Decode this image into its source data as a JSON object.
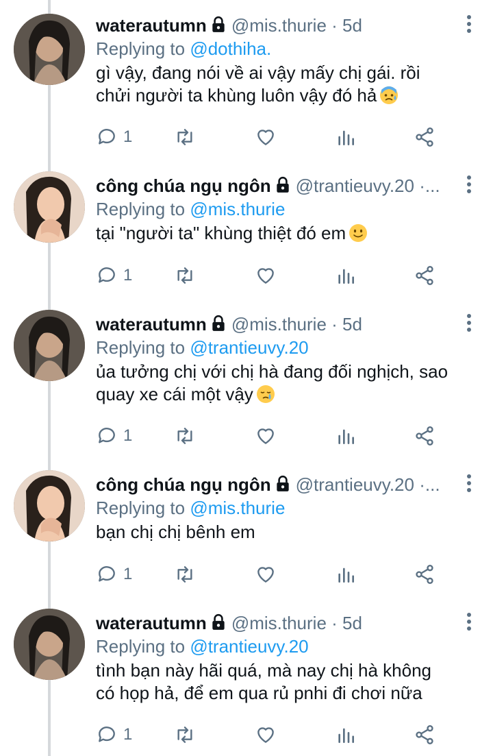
{
  "tweets": [
    {
      "name": "waterautumn",
      "handle": "@mis.thurie",
      "meta": " · 5d",
      "replying_label": "Replying to ",
      "replying_to": "@dothiha.",
      "lines": [
        "gì vậy, đang nói về ai vậy mấy chị gái. rồi",
        "chửi người ta khùng luôn vậy đó hả"
      ],
      "emoji": "anxious-sweat-emoji",
      "replies": "1"
    },
    {
      "name": "công chúa ngụ ngôn",
      "handle": "@trantieuvy.20",
      "meta": " ·...",
      "replying_label": "Replying to ",
      "replying_to": "@mis.thurie",
      "lines": [
        "tại \"người ta\" khùng thiệt đó em"
      ],
      "emoji": "slight-smile-emoji",
      "replies": "1"
    },
    {
      "name": "waterautumn",
      "handle": "@mis.thurie",
      "meta": " · 5d",
      "replying_label": "Replying to ",
      "replying_to": "@trantieuvy.20",
      "lines": [
        "ủa tưởng chị với chị hà đang đối nghịch, sao",
        "quay xe cái một vậy"
      ],
      "emoji": "crying-emoji",
      "replies": "1"
    },
    {
      "name": "công chúa ngụ ngôn",
      "handle": "@trantieuvy.20",
      "meta": " ·...",
      "replying_label": "Replying to ",
      "replying_to": "@mis.thurie",
      "lines": [
        "bạn chị chị bênh em"
      ],
      "emoji": "",
      "replies": "1"
    },
    {
      "name": "waterautumn",
      "handle": "@mis.thurie",
      "meta": " · 5d",
      "replying_label": "Replying to ",
      "replying_to": "@trantieuvy.20",
      "lines": [
        "tình bạn này hãi quá, mà nay chị hà không",
        "có họp hả, để em qua rủ pnhi đi chơi nữa"
      ],
      "emoji": "",
      "replies": "1"
    }
  ],
  "colors": {
    "accent": "#1d9bf0",
    "muted": "#5b7083",
    "text": "#0f1419"
  },
  "icons": [
    "lock-icon",
    "more-options-icon",
    "reply-icon",
    "retweet-icon",
    "like-icon",
    "analytics-icon",
    "share-icon"
  ]
}
